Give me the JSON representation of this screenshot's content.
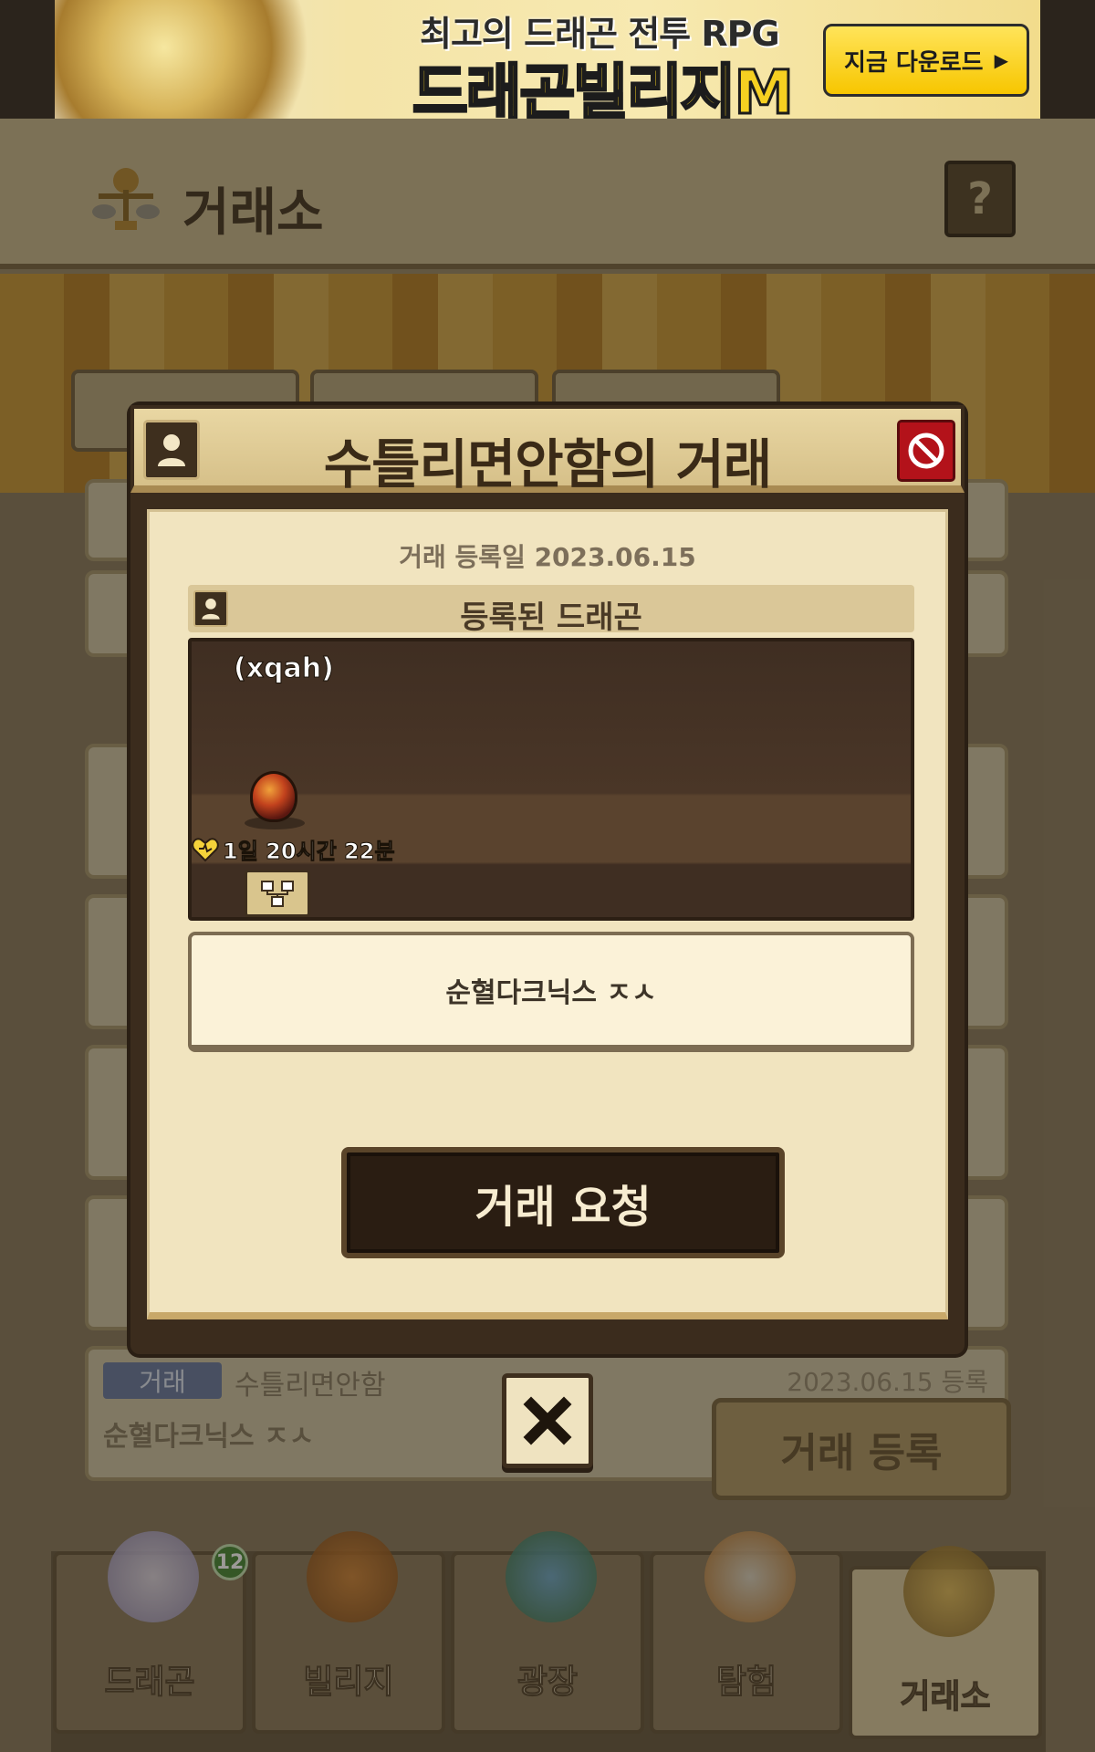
{
  "ad": {
    "headline": "최고의 드래곤 전투 RPG",
    "title": "드래곤빌리지M",
    "cta": "지금 다운로드",
    "cta_arrow": "▶"
  },
  "header": {
    "title": "거래소",
    "help_label": "?"
  },
  "background_list": [
    {
      "badge": "거래",
      "seller": "수틀리면안함",
      "date": "2023.06.15 등록",
      "name": "순혈다크닉스 ㅈㅅ"
    }
  ],
  "register_button": "거래 등록",
  "navbar": {
    "items": [
      {
        "label": "드래곤",
        "badge": "12"
      },
      {
        "label": "빌리지"
      },
      {
        "label": "광장"
      },
      {
        "label": "탐험"
      },
      {
        "label": "거래소",
        "active": true
      }
    ]
  },
  "modal": {
    "title": "수틀리면안함의 거래",
    "registered_date": "거래 등록일 2023.06.15",
    "section_title": "등록된 드래곤",
    "dragon": {
      "name": "(xqah)",
      "timer": "1일 20시간 22분"
    },
    "memo": "순혈다크닉스 ㅈㅅ",
    "request_button": "거래 요청"
  },
  "colors": {
    "modal_frame": "#3b2c1d",
    "modal_body": "#f1e4bf",
    "block_red": "#b3121a",
    "accent_gold": "#f6d021"
  }
}
